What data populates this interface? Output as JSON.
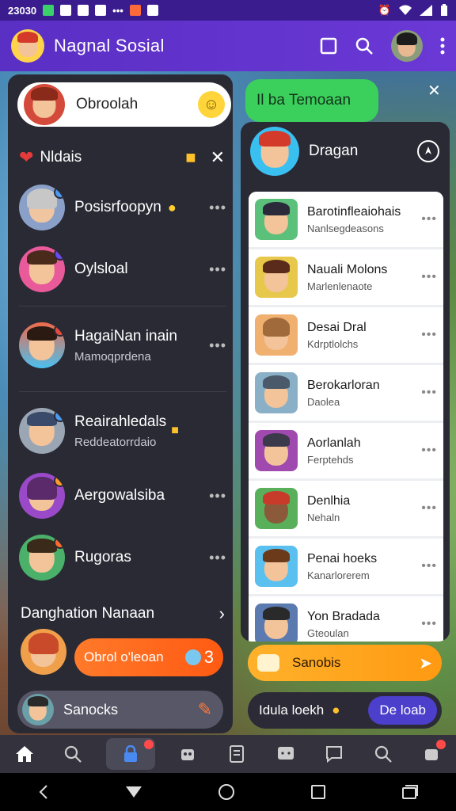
{
  "status_bar": {
    "time": "23030"
  },
  "app": {
    "title": "Nagnal Sosial"
  },
  "left_panel": {
    "top_card": {
      "label": "Obroolah"
    },
    "section": {
      "title": "Nldais"
    },
    "contacts": [
      {
        "name": "Posisrfoopyn",
        "subtitle": ""
      },
      {
        "name": "Oylsloal",
        "subtitle": ""
      },
      {
        "name": "HagaiNan inain",
        "subtitle": "Mamoqprdena"
      },
      {
        "name": "Reairahledals",
        "subtitle": "Reddeatorrdaio"
      },
      {
        "name": "Aergowalsiba",
        "subtitle": ""
      },
      {
        "name": "Rugoras",
        "subtitle": ""
      }
    ],
    "danghation": {
      "label": "Danghation Nanaan"
    },
    "orange_button": {
      "label": "Obrol o'leoan",
      "count": "3"
    },
    "bottom_search": {
      "label": "Sanocks"
    }
  },
  "right_panel": {
    "friend_bubble": "Il ba Temoaan",
    "header": {
      "label": "Dragan"
    },
    "cards": [
      {
        "name": "Barotinfleaiohais",
        "subtitle": "Nanlsegdeasons"
      },
      {
        "name": "Nauali Molons",
        "subtitle": "Marlenlenaote"
      },
      {
        "name": "Desai Dral",
        "subtitle": "Kdrptlolchs"
      },
      {
        "name": "Berokarloran",
        "subtitle": "Daolea"
      },
      {
        "name": "Aorlanlah",
        "subtitle": "Ferptehds"
      },
      {
        "name": "Denlhia",
        "subtitle": "Nehaln"
      },
      {
        "name": "Penai hoeks",
        "subtitle": "Kanarlorerem"
      },
      {
        "name": "Yon Bradada",
        "subtitle": "Gteoulan"
      }
    ],
    "yellow_button": {
      "label": "Sanobis"
    },
    "pill_row": {
      "left": "Idula loekh",
      "right": "De loab"
    }
  },
  "icons": [
    "home-icon",
    "search-icon",
    "lock-icon",
    "bot-icon",
    "document-icon",
    "message-icon",
    "chat-icon",
    "zoom-icon",
    "notifications-icon"
  ],
  "colors": {
    "status": "#3a1c8e",
    "appbar": "#5a2fc4",
    "accent_orange": "#ff5a12",
    "accent_green": "#3bd05c",
    "accent_yellow": "#ffb12b"
  }
}
